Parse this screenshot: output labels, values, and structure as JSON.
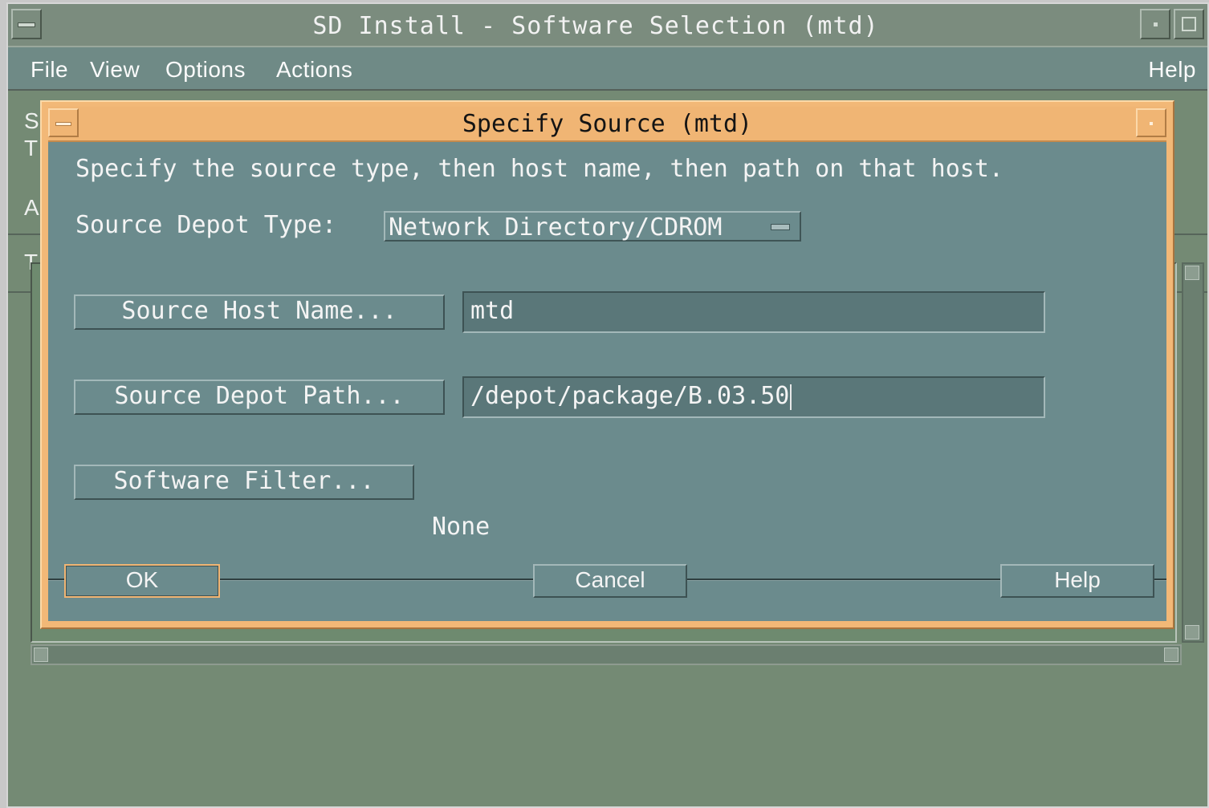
{
  "main_window": {
    "title": "SD Install - Software Selection (mtd)",
    "menu": {
      "file": "File",
      "view": "View",
      "options": "Options",
      "actions": "Actions",
      "help": "Help"
    },
    "partial_labels": [
      "S",
      "T",
      "A",
      "T"
    ]
  },
  "dialog": {
    "title": "Specify Source (mtd)",
    "instruction": "Specify the source type, then host name, then path on that host.",
    "depot_type_label": "Source Depot Type:",
    "depot_type_value": "Network Directory/CDROM",
    "host_button": "Source Host Name...",
    "host_value": "mtd",
    "path_button": "Source Depot Path...",
    "path_value": "/depot/package/B.03.50",
    "filter_button": "Software Filter...",
    "filter_value": "None",
    "ok": "OK",
    "cancel": "Cancel",
    "help": "Help"
  },
  "colors": {
    "dialog_frame": "#f2b877",
    "dialog_content": "#6b8b8d",
    "main_background": "#748a74",
    "menubar": "#6f8a86"
  }
}
